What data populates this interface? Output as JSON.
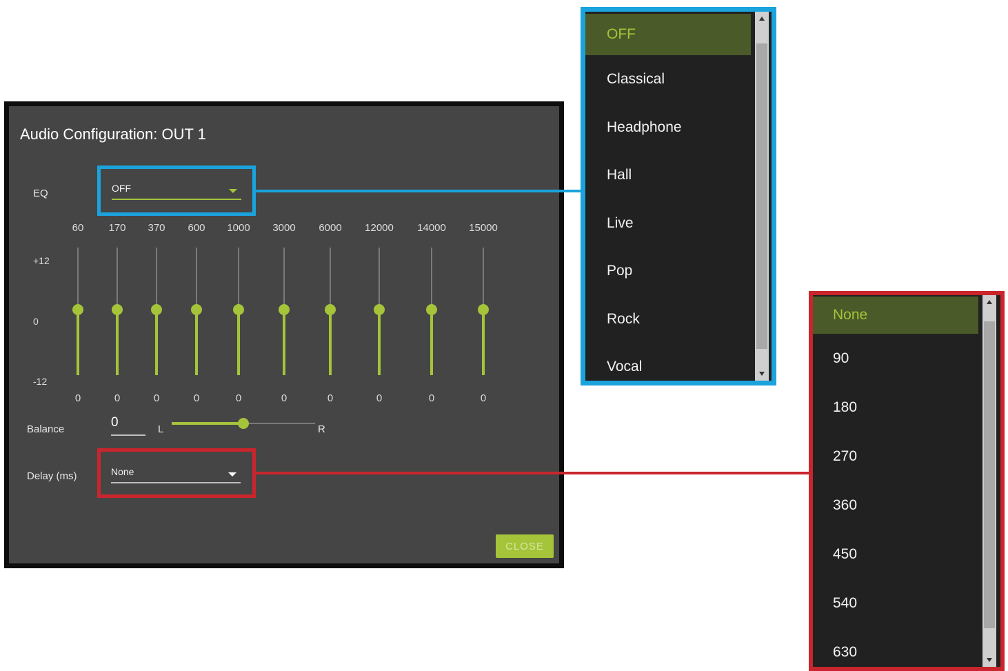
{
  "dialog": {
    "title": "Audio Configuration: OUT 1",
    "eq": {
      "label": "EQ",
      "value": "OFF"
    },
    "frequencies": [
      "60",
      "170",
      "370",
      "600",
      "1000",
      "3000",
      "6000",
      "12000",
      "14000",
      "15000"
    ],
    "scale": {
      "max": "+12",
      "mid": "0",
      "min": "-12"
    },
    "band_levels": [
      "0",
      "0",
      "0",
      "0",
      "0",
      "0",
      "0",
      "0",
      "0",
      "0"
    ],
    "balance": {
      "label": "Balance",
      "value": "0",
      "left": "L",
      "right": "R",
      "position": 0.5
    },
    "delay": {
      "label": "Delay (ms)",
      "value": "None"
    },
    "close_label": "CLOSE"
  },
  "eq_dropdown": {
    "selected": "OFF",
    "options": [
      "OFF",
      "Classical",
      "Headphone",
      "Hall",
      "Live",
      "Pop",
      "Rock",
      "Vocal"
    ]
  },
  "delay_dropdown": {
    "selected": "None",
    "options": [
      "None",
      "90",
      "180",
      "270",
      "360",
      "450",
      "540",
      "630"
    ]
  },
  "colors": {
    "accent": "#a5c43a",
    "eq_highlight": "#1aa3dc",
    "delay_highlight": "#c9252c",
    "dialog_bg": "#454545",
    "list_bg": "#212121"
  }
}
